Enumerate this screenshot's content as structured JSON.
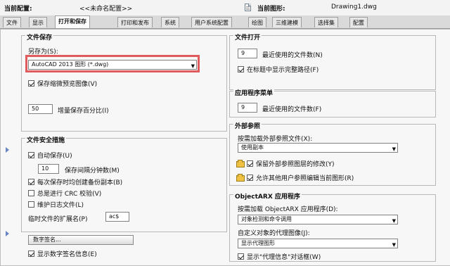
{
  "header": {
    "current_profile_label": "当前配置:",
    "current_profile_value": "<<未命名配置>>",
    "current_drawing_label": "当前图形:",
    "current_drawing_value": "Drawing1.dwg"
  },
  "tabs": [
    {
      "label": "文件"
    },
    {
      "label": "显示"
    },
    {
      "label": "打开和保存"
    },
    {
      "label": "打印和发布"
    },
    {
      "label": "系统"
    },
    {
      "label": "用户系统配置"
    },
    {
      "label": "绘图"
    },
    {
      "label": "三维建模"
    },
    {
      "label": "选择集"
    },
    {
      "label": "配置"
    }
  ],
  "left": {
    "file_save_group": "文件保存",
    "save_as_label": "另存为(S):",
    "save_as_value": "AutoCAD 2013 图形 (*.dwg)",
    "save_thumbnail": "保存缩微预览图像(V)",
    "incremental_save": "增量保存百分比(I)",
    "incremental_value": "50",
    "file_safety_group": "文件安全措施",
    "autosave": "自动保存(U)",
    "autosave_minutes": "10",
    "autosave_unit": "保存间隔分钟数(M)",
    "create_backup": "每次保存时均创建备份副本(B)",
    "full_crc": "总是进行 CRC 校验(V)",
    "log_file": "维护日志文件(L)",
    "temp_ext_label": "临时文件的扩展名(P)",
    "temp_ext_value": "ac$",
    "digital_signature_button": "数字签名...",
    "show_signature_info": "显示数字签名信息(E)",
    "file_open_group": "文件打开",
    "recent_files_label": "最近使用的文件数(N)",
    "recent_files_value": "9",
    "show_full_path": "在标题中显示完整路径(F)",
    "external_ref_group": "外部参照",
    "demand_load_label": "按需加载外部参照文件(X):",
    "demand_load_value": "使用副本",
    "retain_changes": "保留外部参照图层的修改(Y)",
    "allow_edit": "允许其他用户参照编辑当前图形(R)"
  },
  "right": {
    "file_open_group": "文件打开",
    "recent_files_label": "最近使用的文件数(N)",
    "recent_files_value": "9",
    "show_full_path": "在标题中显示完整路径(F)",
    "app_menu_group": "应用程序菜单",
    "app_recent_label": "最近使用的文件数(F)",
    "app_recent_value": "9",
    "xref_group": "外部参照",
    "demand_load_label": "按需加载外部参照文件(X):",
    "demand_load_value": "使用副本",
    "retain_changes": "保留外部参照图层的修改(Y)",
    "allow_edit": "允许其他用户参照编辑当前图形(R)",
    "objectarx_group": "ObjectARX 应用程序",
    "demand_arx_label": "按需加载 ObjectARX 应用程序(D):",
    "demand_arx_value": "对象检测和命令调用",
    "proxy_label": "自定义对象的代理图像(J):",
    "proxy_value": "显示代理图形",
    "proxy_info": "显示\"代理信息\"对话框(W)"
  },
  "colors": {
    "highlight": "#e05c5c",
    "panel": "#f7f7f7",
    "tab_active": "#ffffff"
  }
}
